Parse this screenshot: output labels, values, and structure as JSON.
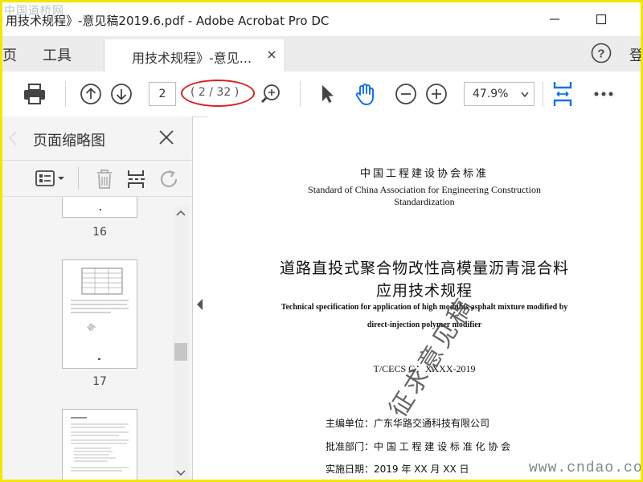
{
  "window": {
    "title": "用技术规程》-意见稿2019.6.pdf - Adobe Acrobat Pro DC",
    "watermark_top_left": "中国道桥网"
  },
  "tabs": {
    "home": "页",
    "tools": "工具",
    "document": "用技术规程》-意见...",
    "login": "登"
  },
  "toolbar": {
    "page_number": "2",
    "page_count": "( 2 / 32 )",
    "zoom": "47.9%"
  },
  "thumbnail_panel": {
    "title": "页面缩略图",
    "pages": [
      {
        "label": "16"
      },
      {
        "label": "17"
      }
    ]
  },
  "document": {
    "standard_cn": "中国工程建设协会标准",
    "standard_en_1": "Standard of China Association for Engineering Construction",
    "standard_en_2": "Standardization",
    "title_cn_1": "道路直投式聚合物改性高模量沥青混合料",
    "title_cn_2": "应用技术规程",
    "title_en_1": "Technical specification for application of high modulus asphalt mixture modified by",
    "title_en_2": "direct-injection polymer modifier",
    "code": "T/CECS G：XXXX-2019",
    "editor": "主编单位：广东华路交通科技有限公司",
    "approver": "批准部门：中 国 工 程 建 设 标 准 化 协 会",
    "date": "实施日期：2019 年 XX 月 XX 日",
    "stamp": "征求意见稿"
  },
  "watermark_bottom_right": "www.cndao.com",
  "colors": {
    "frame": "#f3e600",
    "accent_blue": "#1473e6",
    "annotation_red": "#d92020"
  }
}
